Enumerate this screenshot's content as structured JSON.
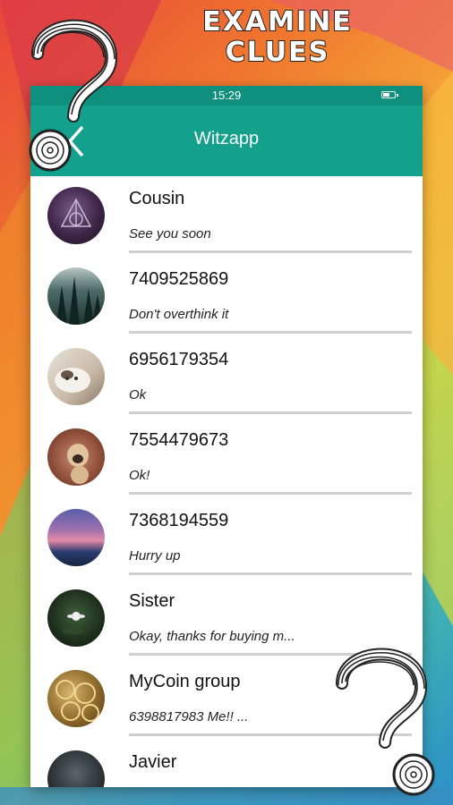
{
  "headline": {
    "line1": "EXAMINE",
    "line2": "CLUES"
  },
  "status_bar": {
    "time": "15:29"
  },
  "app_bar": {
    "title": "Witzapp"
  },
  "chats": [
    {
      "name": "Cousin",
      "message": "See you soon",
      "avatar": "dark-purple-symbol"
    },
    {
      "name": "7409525869",
      "message": "Don't overthink it",
      "avatar": "forest"
    },
    {
      "name": "6956179354",
      "message": "Ok",
      "avatar": "cat"
    },
    {
      "name": "7554479673",
      "message": "Ok!",
      "avatar": "pug"
    },
    {
      "name": "7368194559",
      "message": "Hurry up",
      "avatar": "sunset"
    },
    {
      "name": "Sister",
      "message": "Okay, thanks for buying m...",
      "avatar": "water-lily"
    },
    {
      "name": "MyCoin group",
      "message": "6398817983  Me!! ...",
      "avatar": "coins"
    },
    {
      "name": "Javier",
      "message": "",
      "avatar": "dark-photo"
    }
  ],
  "colors": {
    "status_bar": "#0f8f7e",
    "app_bar": "#13a08d",
    "divider": "#cfcfcf"
  },
  "icons": {
    "back": "chevron-left-icon",
    "battery": "battery-icon",
    "decor": "maze-question-mark-icon"
  }
}
